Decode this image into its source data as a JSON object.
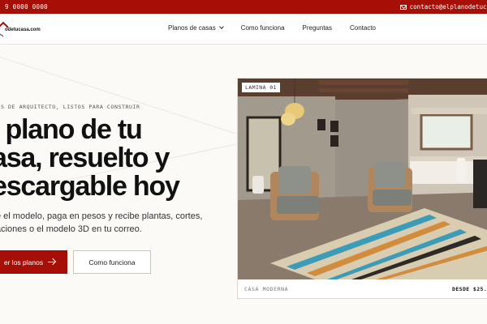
{
  "topbar": {
    "phone": "9 0000 0000",
    "email": "contacto@elplanodetuca",
    "icon": "mail-icon"
  },
  "nav": {
    "logo_text": "odetucasa.com",
    "menu": [
      {
        "label": "Planos de casas"
      },
      {
        "label": "Como funciona"
      },
      {
        "label": "Preguntas"
      },
      {
        "label": "Contacto"
      }
    ]
  },
  "hero": {
    "eyebrow": "NOS DE ARQUITECTO, LISTOS PARA CONSTRUIR",
    "headline": [
      "l plano de tu",
      "asa, resuelto y",
      "escargable hoy"
    ],
    "sub": [
      "e el modelo, paga en pesos y recibe plantas, cortes,",
      "aciones o el modelo 3D en tu correo."
    ],
    "cta_primary": "er los planos",
    "cta_secondary": "Como funciona"
  },
  "card": {
    "label": "LAMINA 01",
    "caption": "CASA MODERNA",
    "price": "DESDE $25."
  },
  "colors": {
    "brand_red": "#a50f05",
    "background": "#fbfaf7"
  }
}
